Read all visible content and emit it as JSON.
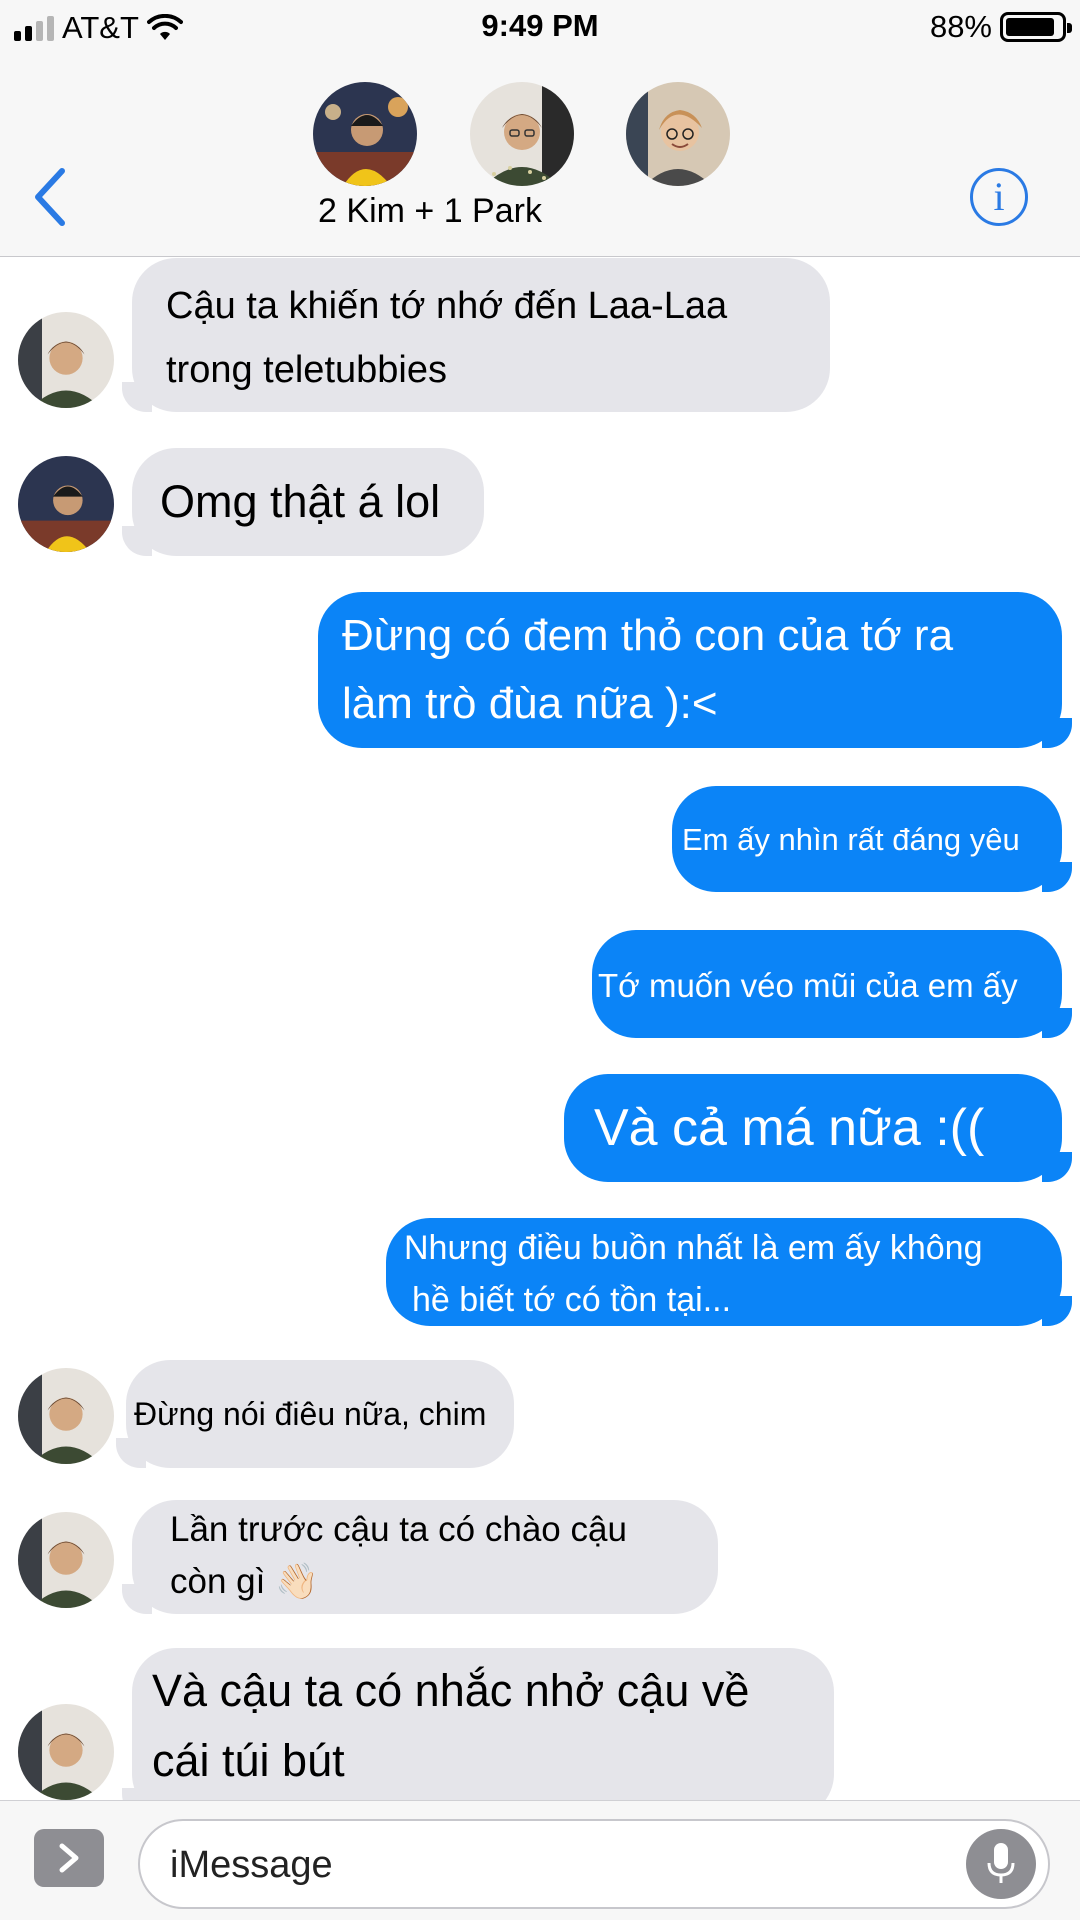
{
  "status_bar": {
    "carrier": "AT&T",
    "time": "9:49 PM",
    "battery_percent": "88%",
    "battery_level": 0.88,
    "signal_bars": 4,
    "signal_filled": 2
  },
  "header": {
    "group_name": "2 Kim + 1 Park",
    "info_icon": "i"
  },
  "messages": [
    {
      "direction": "in",
      "lines": [
        "Cậu ta khiến tớ nhớ đến Laa-Laa",
        "trong teletubbies"
      ]
    },
    {
      "direction": "in",
      "lines": [
        "Omg thật á lol"
      ]
    },
    {
      "direction": "out",
      "lines": [
        "Đừng có đem thỏ con của tớ ra",
        "làm trò đùa nữa ):<"
      ]
    },
    {
      "direction": "out",
      "lines": [
        "Em ấy nhìn rất đáng yêu"
      ]
    },
    {
      "direction": "out",
      "lines": [
        "Tớ muốn véo mũi của em ấy"
      ]
    },
    {
      "direction": "out",
      "lines": [
        "Và cả má nữa :(("
      ]
    },
    {
      "direction": "out",
      "lines": [
        "Nhưng điều buồn nhất là em ấy không",
        "hề biết tớ có tồn tại..."
      ]
    },
    {
      "direction": "in",
      "lines": [
        "Đừng nói điêu nữa, chim"
      ]
    },
    {
      "direction": "in",
      "lines": [
        "Lần trước cậu ta có chào cậu",
        "còn gì 👋🏻"
      ]
    },
    {
      "direction": "in",
      "lines": [
        "Và cậu ta có nhắc nhở cậu về",
        "cái túi bút"
      ]
    }
  ],
  "input": {
    "placeholder": "iMessage"
  },
  "colors": {
    "outgoing_bubble": "#0b84f7",
    "incoming_bubble": "#e5e5ea",
    "accent": "#2a7ae4",
    "bar_background": "#f7f7f7"
  },
  "icons": {
    "back": "chevron-left-icon",
    "info": "info-icon",
    "apps": "chevron-right-icon",
    "mic": "microphone-icon",
    "wifi": "wifi-icon",
    "battery": "battery-icon",
    "signal": "signal-icon"
  }
}
